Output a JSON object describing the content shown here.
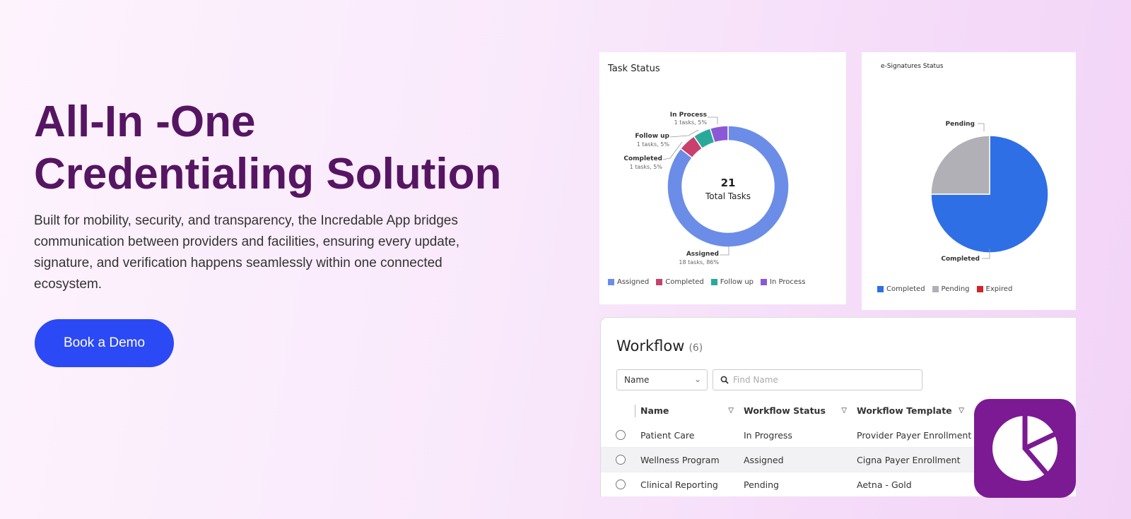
{
  "hero": {
    "title_line1": "All-In -One",
    "title_line2": "Credentialing Solution",
    "description": "Built for mobility, security, and transparency, the Incredable App bridges communication between providers and facilities, ensuring every update, signature, and verification happens seamlessly within one connected ecosystem.",
    "cta_label": "Book a Demo"
  },
  "task_status": {
    "title": "Task Status",
    "center_value": "21",
    "center_label": "Total Tasks",
    "callouts": {
      "in_process": {
        "label": "In Process",
        "detail": "1 tasks, 5%"
      },
      "follow_up": {
        "label": "Follow up",
        "detail": "1 tasks, 5%"
      },
      "completed": {
        "label": "Completed",
        "detail": "1 tasks, 5%"
      },
      "assigned": {
        "label": "Assigned",
        "detail": "18 tasks, 86%"
      }
    },
    "legend": [
      {
        "label": "Assigned",
        "color": "#6b8de8"
      },
      {
        "label": "Completed",
        "color": "#c8416c"
      },
      {
        "label": "Follow up",
        "color": "#2aa99b"
      },
      {
        "label": "In Process",
        "color": "#8b59d6"
      }
    ]
  },
  "esignatures": {
    "title": "e-Signatures Status",
    "callouts": {
      "pending": "Pending",
      "completed": "Completed"
    },
    "legend": [
      {
        "label": "Completed",
        "color": "#2f6fe6"
      },
      {
        "label": "Pending",
        "color": "#b0b0b6"
      },
      {
        "label": "Expired",
        "color": "#d2232a"
      }
    ]
  },
  "chart_data": [
    {
      "type": "pie",
      "title": "Task Status",
      "categories": [
        "Assigned",
        "Completed",
        "Follow up",
        "In Process"
      ],
      "values": [
        18,
        1,
        1,
        1
      ],
      "legend": "bottom"
    },
    {
      "type": "pie",
      "title": "e-Signatures Status",
      "categories": [
        "Completed",
        "Pending",
        "Expired"
      ],
      "values": [
        75,
        25,
        0
      ],
      "legend": "bottom"
    }
  ],
  "workflow": {
    "title": "Workflow",
    "count": "(6)",
    "filter_value": "Name",
    "search_placeholder": "Find Name",
    "columns": [
      "Name",
      "Workflow Status",
      "Workflow Template"
    ],
    "rows": [
      {
        "name": "Patient Care",
        "status": "In Progress",
        "template": "Provider Payer Enrollment"
      },
      {
        "name": "Wellness Program",
        "status": "Assigned",
        "template": "Cigna Payer Enrollment"
      },
      {
        "name": "Clinical Reporting",
        "status": "Pending",
        "template": "Aetna - Gold"
      }
    ]
  },
  "logo": {
    "icon": "pie-chart-logo-icon",
    "color": "#7b1a93"
  }
}
